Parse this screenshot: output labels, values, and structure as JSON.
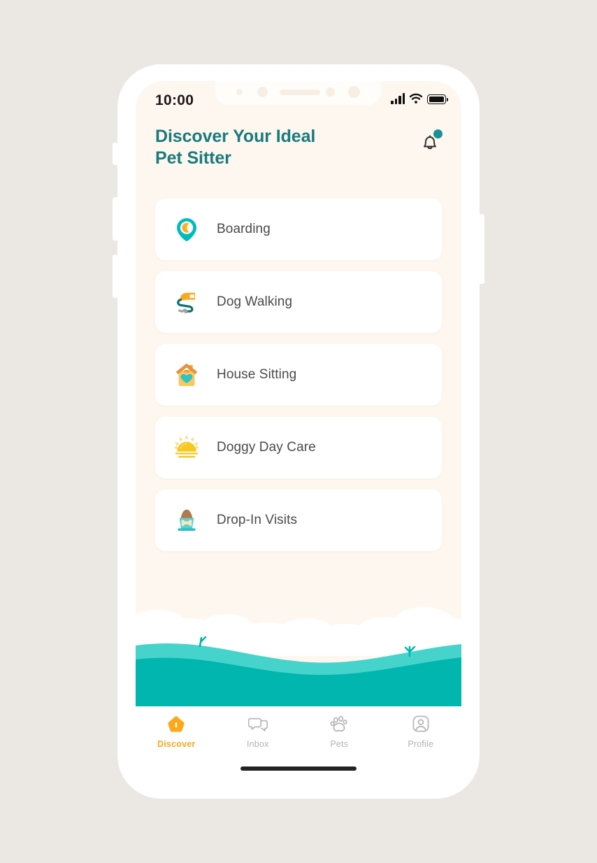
{
  "app": {
    "background_color": "#EBE8E4",
    "screen_color": "#FDF7EF",
    "accent_teal": "#1A7A7E",
    "accent_orange": "#FBA81C"
  },
  "status_bar": {
    "time": "10:00",
    "signal_icon": "signal-bars-icon",
    "wifi_icon": "wifi-icon",
    "battery_icon": "battery-full-icon"
  },
  "header": {
    "title_line1": "Discover Your Ideal",
    "title_line2": "Pet Sitter",
    "notification_icon": "bell-icon",
    "notification_badge": true,
    "badge_color": "#1A9295"
  },
  "services": [
    {
      "label": "Boarding",
      "icon": "map-pin-moon-icon"
    },
    {
      "label": "Dog Walking",
      "icon": "leash-icon"
    },
    {
      "label": "House Sitting",
      "icon": "house-heart-icon"
    },
    {
      "label": "Doggy Day Care",
      "icon": "sunrise-icon"
    },
    {
      "label": "Drop-In Visits",
      "icon": "food-bowl-icon"
    }
  ],
  "tabs": [
    {
      "label": "Discover",
      "icon": "dog-house-icon",
      "active": true
    },
    {
      "label": "Inbox",
      "icon": "chat-bubbles-icon",
      "active": false
    },
    {
      "label": "Pets",
      "icon": "paw-print-icon",
      "active": false
    },
    {
      "label": "Profile",
      "icon": "person-square-icon",
      "active": false
    }
  ]
}
